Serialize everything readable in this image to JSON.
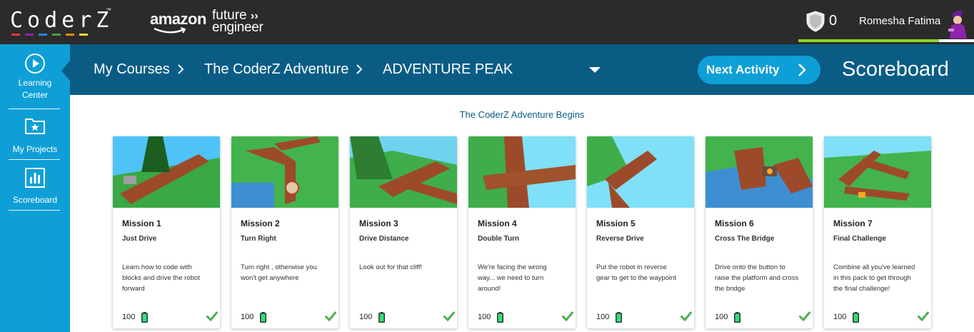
{
  "app": {
    "logo_text": "CoderZ",
    "logo_tm": "™",
    "logo_bar_colors": [
      "#e53935",
      "#8e24aa",
      "#1e88e5",
      "#43a047",
      "#fb8c00",
      "#fdd835"
    ],
    "partner_amazon": "amazon",
    "partner_future": "future",
    "partner_engineer": "engineer"
  },
  "user": {
    "points": "0",
    "name": "Romesha Fatima",
    "xp_fraction": 0.8
  },
  "rail": {
    "items": [
      {
        "label_line1": "Learning",
        "label_line2": "Center",
        "icon": "play-circle-icon"
      },
      {
        "label": "My Projects",
        "icon": "folder-star-icon"
      },
      {
        "label": "Scoreboard",
        "icon": "bar-chart-icon"
      }
    ]
  },
  "breadcrumb": {
    "items": [
      "My Courses",
      "The CoderZ Adventure",
      "ADVENTURE PEAK"
    ]
  },
  "header": {
    "next_label": "Next Activity",
    "page_title": "Scoreboard"
  },
  "main": {
    "section_title": "The CoderZ Adventure Begins",
    "missions": [
      {
        "title": "Mission 1",
        "subtitle": "Just Drive",
        "desc": [
          "Learn how to code with",
          "blocks and drive the robot",
          "forward"
        ],
        "score": "100"
      },
      {
        "title": "Mission 2",
        "subtitle": "Turn Right",
        "desc": [
          "Turn right , otherwise you",
          "won't get anywhere"
        ],
        "score": "100"
      },
      {
        "title": "Mission 3",
        "subtitle": "Drive Distance",
        "desc": [
          "Look out for that cliff!"
        ],
        "score": "100"
      },
      {
        "title": "Mission 4",
        "subtitle": "Double Turn",
        "desc": [
          "We're facing the wrong",
          "way... we need to turn",
          "around!"
        ],
        "score": "100"
      },
      {
        "title": "Mission 5",
        "subtitle": "Reverse Drive",
        "desc": [
          "Put the robot in reverse",
          "gear to get to the waypoint"
        ],
        "score": "100"
      },
      {
        "title": "Mission 6",
        "subtitle": "Cross The Bridge",
        "desc": [
          "Drive onto the button to",
          "raise the platform and cross",
          "the bridge"
        ],
        "score": "100"
      },
      {
        "title": "Mission 7",
        "subtitle": "Final Challenge",
        "desc": [
          "Combine all you've learned",
          "in this pack to get through",
          "the final challenge!"
        ],
        "score": "100"
      }
    ]
  },
  "colors": {
    "topbar": "#2b2b2b",
    "rail": "#0e9fd6",
    "header": "#0a5c85",
    "check": "#4caf50",
    "battery": "#2ee07a"
  }
}
